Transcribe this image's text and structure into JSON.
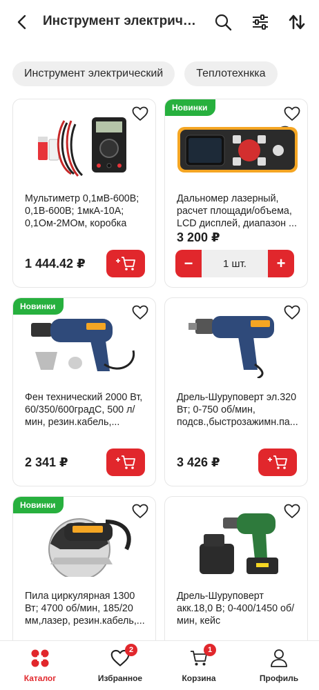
{
  "header": {
    "title": "Инструмент электриче...",
    "icons": {
      "back": "chevron-left-icon",
      "search": "search-icon",
      "filter": "filter-sliders-icon",
      "sort": "sort-arrows-icon"
    }
  },
  "chips": [
    {
      "label": "Инструмент электрический"
    },
    {
      "label": "Теплотехнкка"
    }
  ],
  "badge_text": "Новинки",
  "products": [
    {
      "name": "Мультиметр 0,1мВ-600В; 0,1В-600В; 1мкА-10А; 0,1Ом-2МОм, коробка",
      "price": "1 444.42 ₽",
      "is_new": false,
      "image": "multimeter"
    },
    {
      "name": "Дальномер лазерный, расчет площади/объема, LCD дисплей, диапазон ...",
      "price": "3 200 ₽",
      "is_new": true,
      "image": "laser-rangefinder",
      "quantity": "1 шт."
    },
    {
      "name": "Фен технический 2000 Вт, 60/350/600градС, 500 л/мин, резин.кабель,...",
      "price": "2 341 ₽",
      "is_new": true,
      "image": "heat-gun"
    },
    {
      "name": "Дрель-Шуруповерт эл.320 Вт; 0-750 об/мин, подсв.,быстрозажимн.па...",
      "price": "3 426 ₽",
      "is_new": false,
      "image": "corded-drill"
    },
    {
      "name": "Пила циркулярная 1300 Вт; 4700 об/мин, 185/20 мм,лазер, резин.кабель,...",
      "price": "",
      "is_new": true,
      "image": "circular-saw"
    },
    {
      "name": "Дрель-Шуруповерт акк.18,0 В; 0-400/1450 об/мин, кейс",
      "price": "",
      "is_new": false,
      "image": "cordless-drill"
    }
  ],
  "stepper": {
    "minus": "−",
    "plus": "+"
  },
  "tabbar": {
    "tabs": [
      {
        "label": "Каталог",
        "icon": "catalog-icon",
        "active": true
      },
      {
        "label": "Избранное",
        "icon": "heart-icon",
        "badge": "2"
      },
      {
        "label": "Корзина",
        "icon": "cart-icon",
        "badge": "1"
      },
      {
        "label": "Профиль",
        "icon": "profile-icon"
      }
    ]
  },
  "colors": {
    "accent": "#e1272c",
    "new_badge": "#27b03e",
    "chip_bg": "#efefef"
  }
}
